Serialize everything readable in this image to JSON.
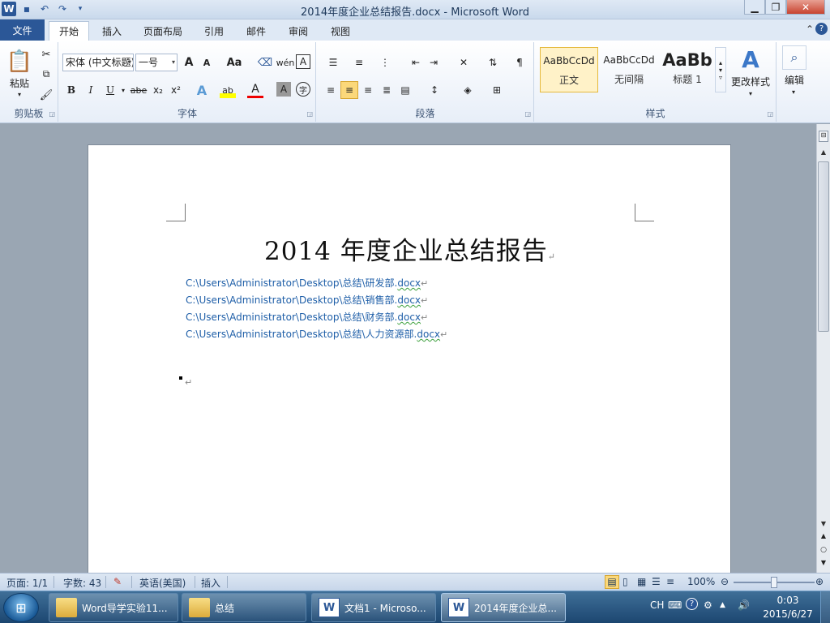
{
  "window": {
    "title": "2014年度企业总结报告.docx - Microsoft Word",
    "app_icon": "W"
  },
  "tabs": [
    "文件",
    "开始",
    "插入",
    "页面布局",
    "引用",
    "邮件",
    "审阅",
    "视图"
  ],
  "ribbon": {
    "clipboard": {
      "paste": "粘贴",
      "label": "剪贴板"
    },
    "font": {
      "font_name": "宋体 (中文标题)",
      "font_size": "一号",
      "grow": "A",
      "shrink": "A",
      "change_case": "Aa",
      "bold": "B",
      "italic": "I",
      "underline": "U",
      "strike": "abe",
      "subscript": "x₂",
      "superscript": "x²",
      "text_effect": "A",
      "highlight": "ab",
      "font_color": "A",
      "char_shading": "A",
      "enclose": "字",
      "phonetic": "wén",
      "border_char": "A",
      "label": "字体"
    },
    "paragraph": {
      "label": "段落"
    },
    "styles": {
      "items": [
        {
          "sample": "AaBbCcDd",
          "name": "正文"
        },
        {
          "sample": "AaBbCcDd",
          "name": "无间隔"
        },
        {
          "sample": "AaBb",
          "name": "标题 1"
        }
      ],
      "change_styles": "更改样式",
      "label": "样式"
    },
    "editing": {
      "label": "编辑"
    }
  },
  "document": {
    "title": "2014 年度企业总结报告",
    "links": [
      {
        "pre": "C:\\Users\\Administrator\\Desktop\\总结\\研发部.",
        "ext": "docx"
      },
      {
        "pre": "C:\\Users\\Administrator\\Desktop\\总结\\销售部.",
        "ext": "docx"
      },
      {
        "pre": "C:\\Users\\Administrator\\Desktop\\总结\\财务部.",
        "ext": "docx"
      },
      {
        "pre": "C:\\Users\\Administrator\\Desktop\\总结\\人力资源部.",
        "ext": "docx"
      }
    ]
  },
  "status": {
    "page": "页面: 1/1",
    "words": "字数: 43",
    "language": "英语(美国)",
    "mode": "插入",
    "zoom": "100%",
    "zoom_level": 0.5
  },
  "taskbar": {
    "items": [
      {
        "label": "Word导学实验11...",
        "type": "folder"
      },
      {
        "label": "总结",
        "type": "folder"
      },
      {
        "label": "文档1 - Microso...",
        "type": "word"
      },
      {
        "label": "2014年度企业总...",
        "type": "word"
      }
    ],
    "ime": "CH",
    "time": "0:03",
    "date": "2015/6/27"
  }
}
